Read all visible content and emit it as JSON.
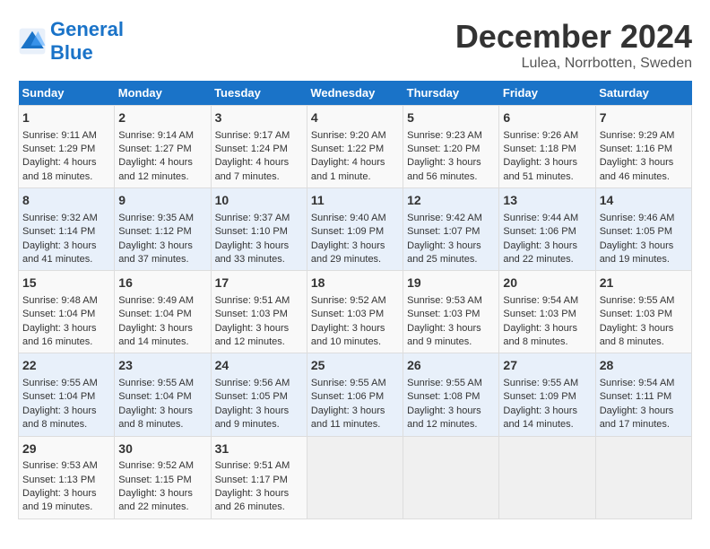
{
  "logo": {
    "text_general": "General",
    "text_blue": "Blue"
  },
  "header": {
    "month": "December 2024",
    "location": "Lulea, Norrbotten, Sweden"
  },
  "weekdays": [
    "Sunday",
    "Monday",
    "Tuesday",
    "Wednesday",
    "Thursday",
    "Friday",
    "Saturday"
  ],
  "weeks": [
    [
      {
        "day": "1",
        "lines": [
          "Sunrise: 9:11 AM",
          "Sunset: 1:29 PM",
          "Daylight: 4 hours",
          "and 18 minutes."
        ]
      },
      {
        "day": "2",
        "lines": [
          "Sunrise: 9:14 AM",
          "Sunset: 1:27 PM",
          "Daylight: 4 hours",
          "and 12 minutes."
        ]
      },
      {
        "day": "3",
        "lines": [
          "Sunrise: 9:17 AM",
          "Sunset: 1:24 PM",
          "Daylight: 4 hours",
          "and 7 minutes."
        ]
      },
      {
        "day": "4",
        "lines": [
          "Sunrise: 9:20 AM",
          "Sunset: 1:22 PM",
          "Daylight: 4 hours",
          "and 1 minute."
        ]
      },
      {
        "day": "5",
        "lines": [
          "Sunrise: 9:23 AM",
          "Sunset: 1:20 PM",
          "Daylight: 3 hours",
          "and 56 minutes."
        ]
      },
      {
        "day": "6",
        "lines": [
          "Sunrise: 9:26 AM",
          "Sunset: 1:18 PM",
          "Daylight: 3 hours",
          "and 51 minutes."
        ]
      },
      {
        "day": "7",
        "lines": [
          "Sunrise: 9:29 AM",
          "Sunset: 1:16 PM",
          "Daylight: 3 hours",
          "and 46 minutes."
        ]
      }
    ],
    [
      {
        "day": "8",
        "lines": [
          "Sunrise: 9:32 AM",
          "Sunset: 1:14 PM",
          "Daylight: 3 hours",
          "and 41 minutes."
        ]
      },
      {
        "day": "9",
        "lines": [
          "Sunrise: 9:35 AM",
          "Sunset: 1:12 PM",
          "Daylight: 3 hours",
          "and 37 minutes."
        ]
      },
      {
        "day": "10",
        "lines": [
          "Sunrise: 9:37 AM",
          "Sunset: 1:10 PM",
          "Daylight: 3 hours",
          "and 33 minutes."
        ]
      },
      {
        "day": "11",
        "lines": [
          "Sunrise: 9:40 AM",
          "Sunset: 1:09 PM",
          "Daylight: 3 hours",
          "and 29 minutes."
        ]
      },
      {
        "day": "12",
        "lines": [
          "Sunrise: 9:42 AM",
          "Sunset: 1:07 PM",
          "Daylight: 3 hours",
          "and 25 minutes."
        ]
      },
      {
        "day": "13",
        "lines": [
          "Sunrise: 9:44 AM",
          "Sunset: 1:06 PM",
          "Daylight: 3 hours",
          "and 22 minutes."
        ]
      },
      {
        "day": "14",
        "lines": [
          "Sunrise: 9:46 AM",
          "Sunset: 1:05 PM",
          "Daylight: 3 hours",
          "and 19 minutes."
        ]
      }
    ],
    [
      {
        "day": "15",
        "lines": [
          "Sunrise: 9:48 AM",
          "Sunset: 1:04 PM",
          "Daylight: 3 hours",
          "and 16 minutes."
        ]
      },
      {
        "day": "16",
        "lines": [
          "Sunrise: 9:49 AM",
          "Sunset: 1:04 PM",
          "Daylight: 3 hours",
          "and 14 minutes."
        ]
      },
      {
        "day": "17",
        "lines": [
          "Sunrise: 9:51 AM",
          "Sunset: 1:03 PM",
          "Daylight: 3 hours",
          "and 12 minutes."
        ]
      },
      {
        "day": "18",
        "lines": [
          "Sunrise: 9:52 AM",
          "Sunset: 1:03 PM",
          "Daylight: 3 hours",
          "and 10 minutes."
        ]
      },
      {
        "day": "19",
        "lines": [
          "Sunrise: 9:53 AM",
          "Sunset: 1:03 PM",
          "Daylight: 3 hours",
          "and 9 minutes."
        ]
      },
      {
        "day": "20",
        "lines": [
          "Sunrise: 9:54 AM",
          "Sunset: 1:03 PM",
          "Daylight: 3 hours",
          "and 8 minutes."
        ]
      },
      {
        "day": "21",
        "lines": [
          "Sunrise: 9:55 AM",
          "Sunset: 1:03 PM",
          "Daylight: 3 hours",
          "and 8 minutes."
        ]
      }
    ],
    [
      {
        "day": "22",
        "lines": [
          "Sunrise: 9:55 AM",
          "Sunset: 1:04 PM",
          "Daylight: 3 hours",
          "and 8 minutes."
        ]
      },
      {
        "day": "23",
        "lines": [
          "Sunrise: 9:55 AM",
          "Sunset: 1:04 PM",
          "Daylight: 3 hours",
          "and 8 minutes."
        ]
      },
      {
        "day": "24",
        "lines": [
          "Sunrise: 9:56 AM",
          "Sunset: 1:05 PM",
          "Daylight: 3 hours",
          "and 9 minutes."
        ]
      },
      {
        "day": "25",
        "lines": [
          "Sunrise: 9:55 AM",
          "Sunset: 1:06 PM",
          "Daylight: 3 hours",
          "and 11 minutes."
        ]
      },
      {
        "day": "26",
        "lines": [
          "Sunrise: 9:55 AM",
          "Sunset: 1:08 PM",
          "Daylight: 3 hours",
          "and 12 minutes."
        ]
      },
      {
        "day": "27",
        "lines": [
          "Sunrise: 9:55 AM",
          "Sunset: 1:09 PM",
          "Daylight: 3 hours",
          "and 14 minutes."
        ]
      },
      {
        "day": "28",
        "lines": [
          "Sunrise: 9:54 AM",
          "Sunset: 1:11 PM",
          "Daylight: 3 hours",
          "and 17 minutes."
        ]
      }
    ],
    [
      {
        "day": "29",
        "lines": [
          "Sunrise: 9:53 AM",
          "Sunset: 1:13 PM",
          "Daylight: 3 hours",
          "and 19 minutes."
        ]
      },
      {
        "day": "30",
        "lines": [
          "Sunrise: 9:52 AM",
          "Sunset: 1:15 PM",
          "Daylight: 3 hours",
          "and 22 minutes."
        ]
      },
      {
        "day": "31",
        "lines": [
          "Sunrise: 9:51 AM",
          "Sunset: 1:17 PM",
          "Daylight: 3 hours",
          "and 26 minutes."
        ]
      },
      null,
      null,
      null,
      null
    ]
  ]
}
